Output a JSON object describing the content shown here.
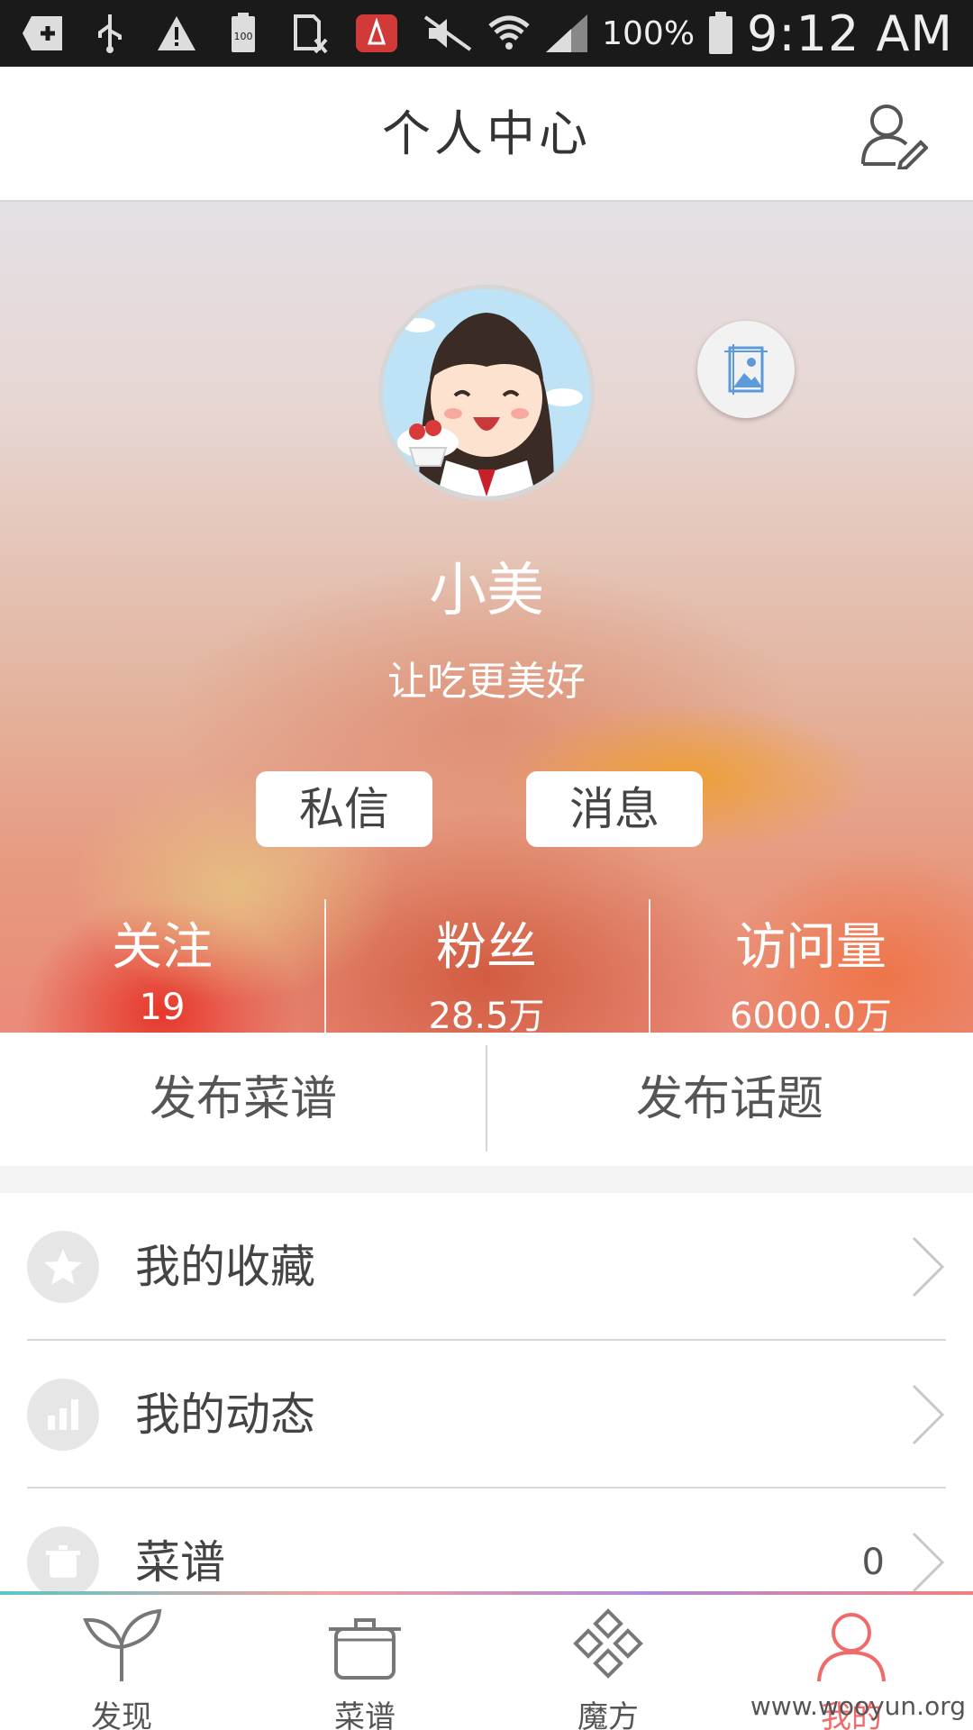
{
  "status_bar": {
    "battery_pct": "100%",
    "time": "9:12 AM",
    "icons": [
      "plus-icon",
      "usb-icon",
      "warning-icon",
      "battery-100-icon",
      "sim-icon",
      "app-icon",
      "mute-icon",
      "wifi-icon",
      "signal-icon",
      "battery-icon"
    ]
  },
  "header": {
    "title": "个人中心",
    "edit_icon": "user-edit-icon"
  },
  "profile": {
    "nickname": "小美",
    "bio": "让吃更美好",
    "bg_change_icon": "image-frame-icon",
    "buttons": {
      "message": "私信",
      "notifications": "消息"
    },
    "stats": [
      {
        "label": "关注",
        "value": "19"
      },
      {
        "label": "粉丝",
        "value": "28.5万"
      },
      {
        "label": "访问量",
        "value": "6000.0万"
      }
    ]
  },
  "publish": {
    "recipe": "发布菜谱",
    "topic": "发布话题"
  },
  "menu": [
    {
      "label": "我的收藏",
      "icon": "star-icon",
      "count": ""
    },
    {
      "label": "我的动态",
      "icon": "chart-icon",
      "count": ""
    },
    {
      "label": "菜谱",
      "icon": "pot-icon",
      "count": "0"
    }
  ],
  "tabbar": {
    "tabs": [
      {
        "label": "发现",
        "icon": "sprout-icon"
      },
      {
        "label": "菜谱",
        "icon": "pot-icon"
      },
      {
        "label": "魔方",
        "icon": "cube-icon"
      },
      {
        "label": "我的",
        "icon": "person-icon"
      }
    ],
    "active_color": "#f06a6a"
  },
  "watermark": "www.wooyun.org"
}
